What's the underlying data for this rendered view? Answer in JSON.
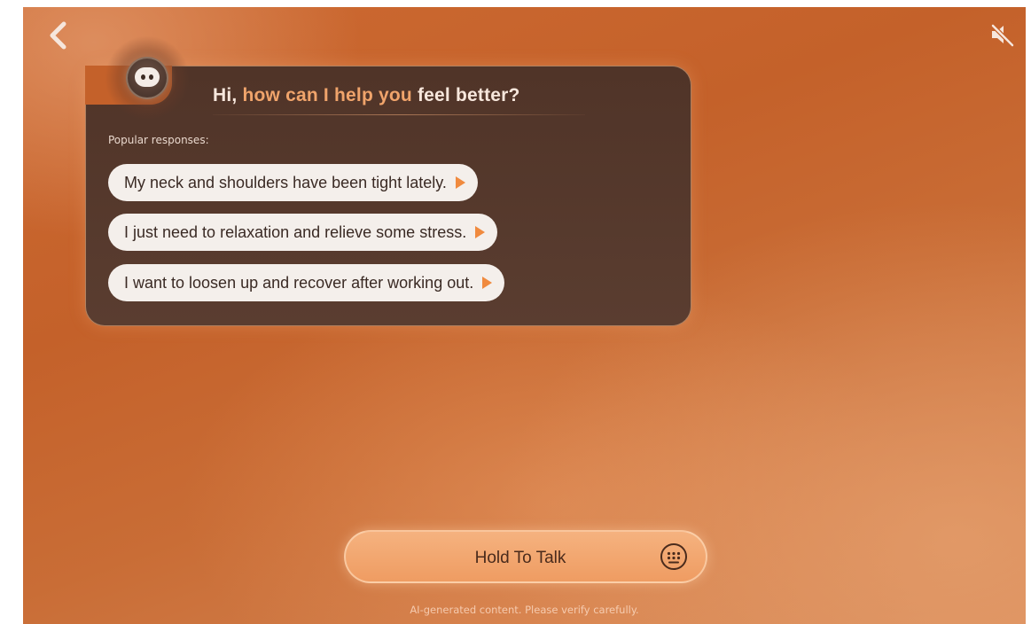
{
  "header": {
    "back_icon": "chevron-left-icon",
    "mute_icon": "speaker-muted-icon"
  },
  "assistant": {
    "avatar_icon": "robot-face-icon"
  },
  "chat": {
    "greeting_part1": "Hi, ",
    "greeting_accent": "how can I help you",
    "greeting_part2": " feel better?",
    "popular_label": "Popular responses:",
    "suggestions": [
      {
        "text": "My neck and shoulders have been tight lately.",
        "icon": "play-triangle-icon"
      },
      {
        "text": "I just need to relaxation and relieve some stress.",
        "icon": "play-triangle-icon"
      },
      {
        "text": "I want to loosen up and recover after working out.",
        "icon": "play-triangle-icon"
      }
    ]
  },
  "input": {
    "talk_label": "Hold To Talk",
    "keyboard_icon": "keyboard-icon"
  },
  "footer": {
    "disclaimer": "AI-generated content. Please verify carefully."
  },
  "colors": {
    "background": "#c4612a",
    "card": "#503428",
    "accent": "#f0a46b",
    "play": "#f08a3e",
    "talk_bar": "#f5b27f"
  }
}
